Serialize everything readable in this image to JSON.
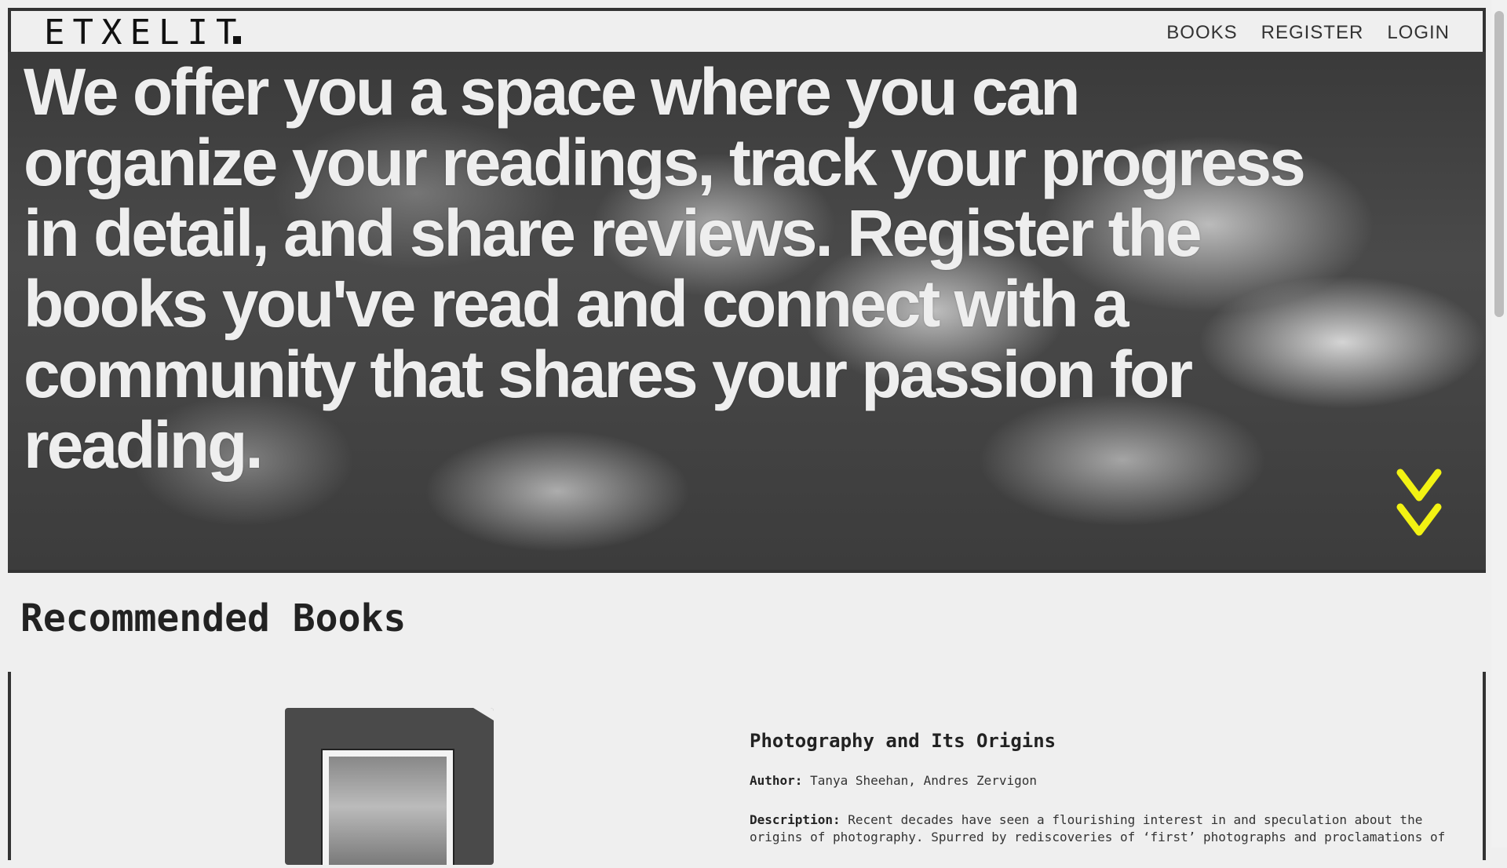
{
  "header": {
    "logo": "ETXELIT",
    "nav": [
      {
        "label": "BOOKS"
      },
      {
        "label": "REGISTER"
      },
      {
        "label": "LOGIN"
      }
    ]
  },
  "hero": {
    "text": "We offer you a space where you can organize your readings, track your progress in detail, and share reviews. Register the books you've read and connect with a community that shares your passion for reading.",
    "scroll_icon": "double-chevron-down-icon",
    "accent_color": "#f2f213"
  },
  "recommended": {
    "title": "Recommended Books",
    "books": [
      {
        "title": "Photography and Its Origins",
        "author_label": "Author:",
        "author": "Tanya Sheehan, Andres Zervigon",
        "description_label": "Description:",
        "description": "Recent decades have seen a flourishing interest in and speculation about the origins of photography. Spurred by rediscoveries of ‘first’ photographs and proclamations of"
      }
    ]
  }
}
